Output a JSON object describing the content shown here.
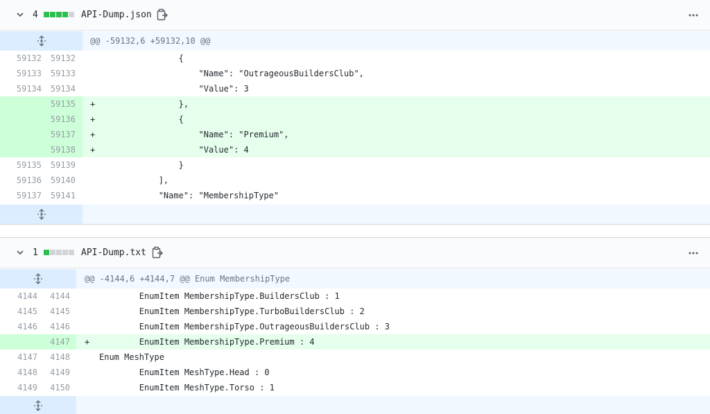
{
  "files": [
    {
      "count": "4",
      "diffstat": [
        "#2cbe4e",
        "#2cbe4e",
        "#2cbe4e",
        "#2cbe4e",
        "#d1d5da"
      ],
      "name": "API-Dump.json",
      "hunk": "@@ -59132,6 +59132,10 @@",
      "lines": [
        {
          "old": "59132",
          "new": "59132",
          "marker": "",
          "code": "                {",
          "added": false
        },
        {
          "old": "59133",
          "new": "59133",
          "marker": "",
          "code": "                    \"Name\": \"OutrageousBuildersClub\",",
          "added": false
        },
        {
          "old": "59134",
          "new": "59134",
          "marker": "",
          "code": "                    \"Value\": 3",
          "added": false
        },
        {
          "old": "",
          "new": "59135",
          "marker": "+",
          "code": "                },",
          "added": true
        },
        {
          "old": "",
          "new": "59136",
          "marker": "+",
          "code": "                {",
          "added": true
        },
        {
          "old": "",
          "new": "59137",
          "marker": "+",
          "code": "                    \"Name\": \"Premium\",",
          "added": true
        },
        {
          "old": "",
          "new": "59138",
          "marker": "+",
          "code": "                    \"Value\": 4",
          "added": true
        },
        {
          "old": "59135",
          "new": "59139",
          "marker": "",
          "code": "                }",
          "added": false
        },
        {
          "old": "59136",
          "new": "59140",
          "marker": "",
          "code": "            ],",
          "added": false
        },
        {
          "old": "59137",
          "new": "59141",
          "marker": "",
          "code": "            \"Name\": \"MembershipType\"",
          "added": false
        }
      ]
    },
    {
      "count": "1",
      "diffstat": [
        "#2cbe4e",
        "#d1d5da",
        "#d1d5da",
        "#d1d5da",
        "#d1d5da"
      ],
      "name": "API-Dump.txt",
      "hunk": "@@ -4144,6 +4144,7 @@ Enum MembershipType",
      "lines": [
        {
          "old": "4144",
          "new": "4144",
          "marker": "",
          "code": "        EnumItem MembershipType.BuildersClub : 1",
          "added": false
        },
        {
          "old": "4145",
          "new": "4145",
          "marker": "",
          "code": "        EnumItem MembershipType.TurboBuildersClub : 2",
          "added": false
        },
        {
          "old": "4146",
          "new": "4146",
          "marker": "",
          "code": "        EnumItem MembershipType.OutrageousBuildersClub : 3",
          "added": false
        },
        {
          "old": "",
          "new": "4147",
          "marker": "+",
          "code": "        EnumItem MembershipType.Premium : 4",
          "added": true
        },
        {
          "old": "4147",
          "new": "4148",
          "marker": "",
          "code": "Enum MeshType",
          "added": false
        },
        {
          "old": "4148",
          "new": "4149",
          "marker": "",
          "code": "        EnumItem MeshType.Head : 0",
          "added": false
        },
        {
          "old": "4149",
          "new": "4150",
          "marker": "",
          "code": "        EnumItem MeshType.Torso : 1",
          "added": false
        }
      ]
    }
  ],
  "icons": {
    "collapse": "chevron-down-icon",
    "copy": "copy-path-icon",
    "more": "kebab-horizontal-icon",
    "expand": "unfold-icon"
  }
}
